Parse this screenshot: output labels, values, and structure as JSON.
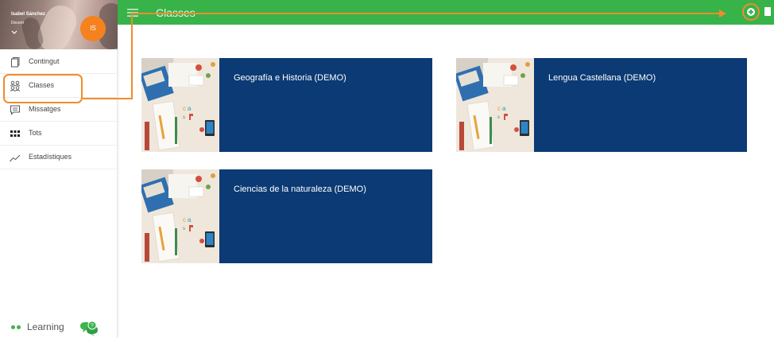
{
  "profile": {
    "name": "Isabel Sánchez",
    "role": "Docent",
    "initials": "IS"
  },
  "topbar": {
    "title": "Classes"
  },
  "menu": {
    "items": [
      {
        "label": "Contingut",
        "icon": "document-icon"
      },
      {
        "label": "Classes",
        "icon": "people-icon"
      },
      {
        "label": "Missatges",
        "icon": "message-icon"
      },
      {
        "label": "Tots",
        "icon": "grid-icon"
      },
      {
        "label": "Estadístiques",
        "icon": "stats-icon"
      }
    ]
  },
  "classes": [
    {
      "title": "Geografía e Historia (DEMO)"
    },
    {
      "title": "Lengua Castellana (DEMO)"
    },
    {
      "title": "Ciencias de la naturaleza (DEMO)"
    }
  ],
  "brand": {
    "label": "Learning"
  },
  "chat": {
    "badge": "?"
  },
  "colors": {
    "topbar": "#37b34a",
    "card": "#0b3a74",
    "avatar": "#f5821f",
    "annotation": "#f08c2b"
  }
}
